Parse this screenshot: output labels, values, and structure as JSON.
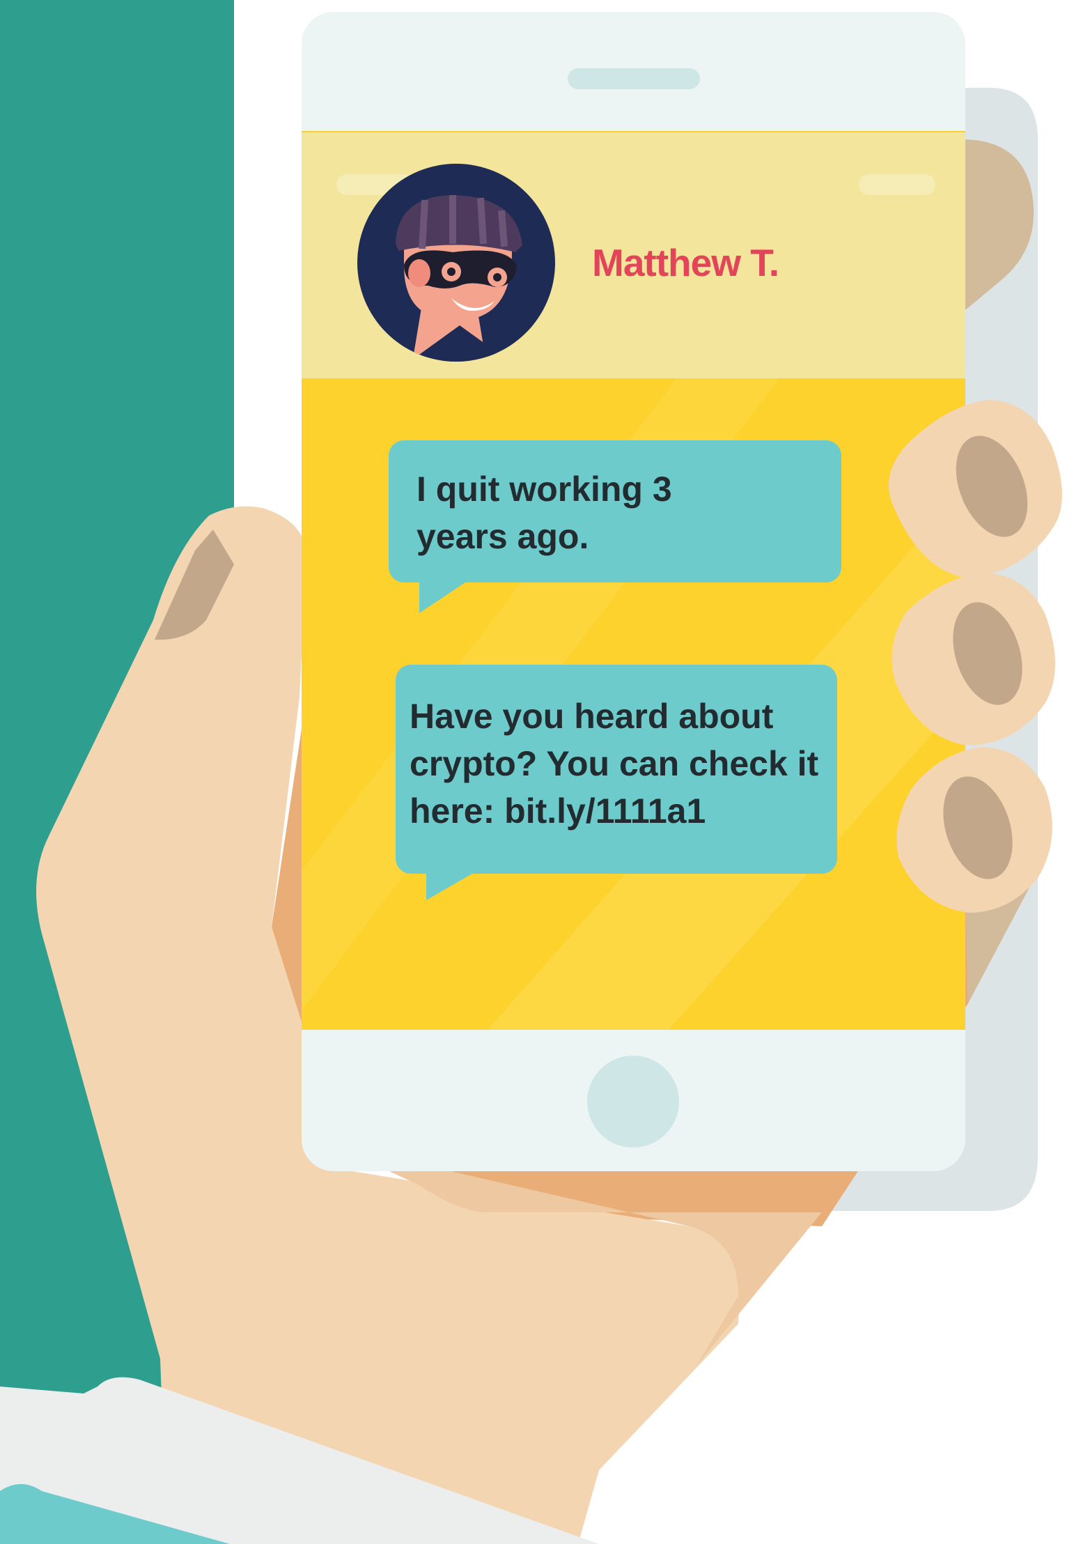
{
  "chat": {
    "contact_name": "Matthew T.",
    "messages": [
      {
        "text": "I quit working 3 years ago."
      },
      {
        "text": "Have you heard about crypto? You can check it here: bit.ly/1111a1"
      }
    ]
  },
  "icons": {
    "avatar": "masked-burglar-avatar",
    "hand": "hand-holding-phone",
    "home_button": "phone-home-button",
    "speaker": "phone-speaker-slot"
  },
  "colors": {
    "teal_band": "#2e9f8f",
    "skin": "#f4d5b1",
    "screen_yellow": "#fdd22c",
    "header_yellow": "#f3e59b",
    "bubble": "#6ecbcc",
    "name_red": "#e2455a",
    "phone_frame": "#edf4f4"
  }
}
